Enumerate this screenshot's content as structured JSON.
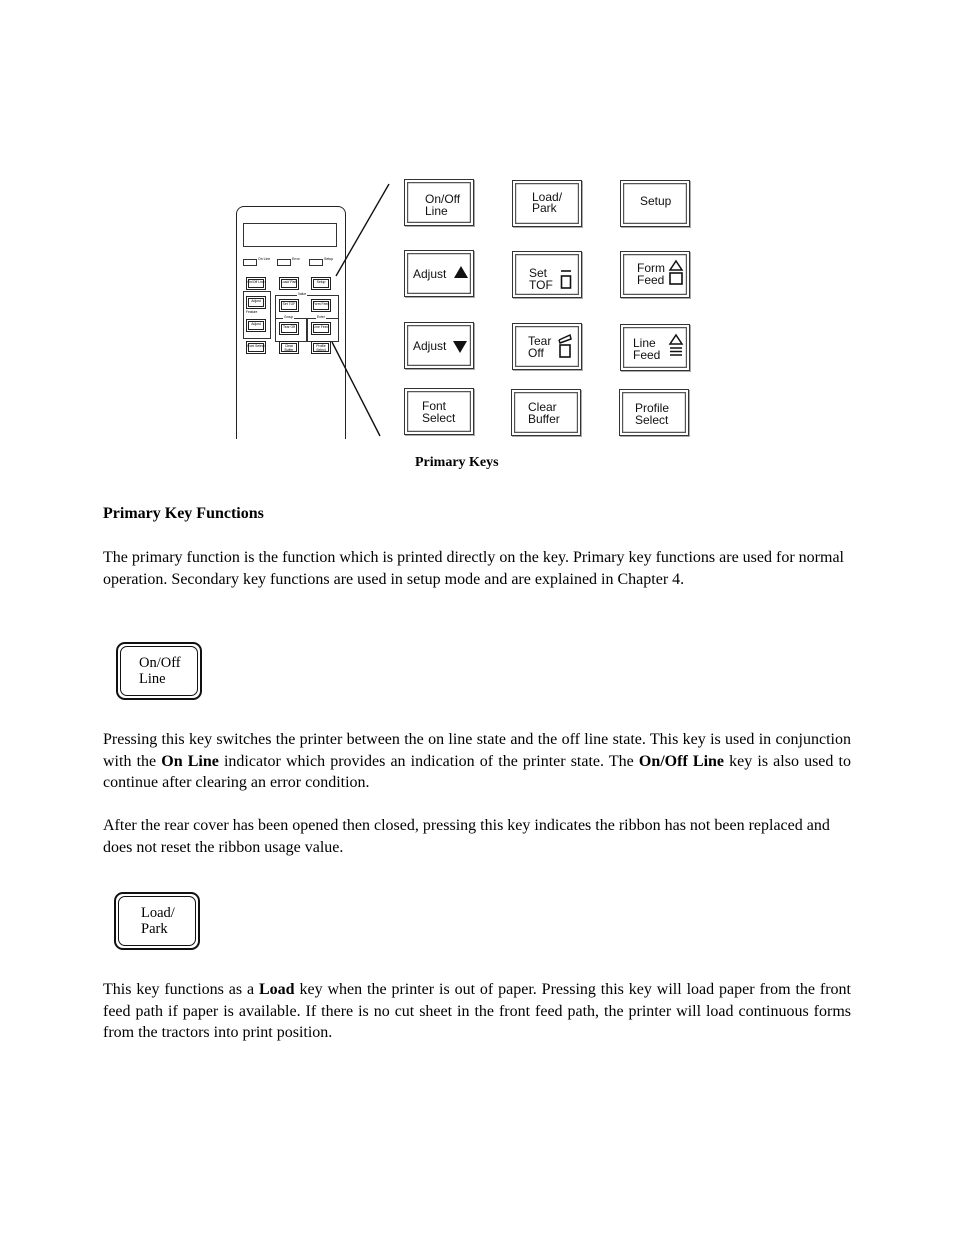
{
  "figure": {
    "caption": "Primary Keys",
    "panel": {
      "indicators": [
        "On Line",
        "Error",
        "Setup"
      ],
      "group_labels": [
        "Value",
        "Feature",
        "Group",
        "Enter"
      ],
      "keys": [
        "On/Off Line",
        "Load/ Park",
        "Setup",
        "Adjust",
        "Set TOF",
        "Form Feed",
        "Adjust",
        "Tear Off",
        "Line Feed",
        "Font Select",
        "Clear Buffer",
        "Profile Select"
      ]
    },
    "keys": [
      {
        "line1": "On/Off",
        "line2": "Line",
        "icon": ""
      },
      {
        "line1": "Load/",
        "line2": "Park",
        "icon": ""
      },
      {
        "line1": "Setup",
        "line2": "",
        "icon": ""
      },
      {
        "line1": "Adjust",
        "line2": "",
        "icon": "triangle-up-icon"
      },
      {
        "line1": "Set",
        "line2": "TOF",
        "icon": "set-tof-icon"
      },
      {
        "line1": "Form",
        "line2": "Feed",
        "icon": "form-feed-icon"
      },
      {
        "line1": "Adjust",
        "line2": "",
        "icon": "triangle-down-icon"
      },
      {
        "line1": "Tear",
        "line2": "Off",
        "icon": "tear-off-icon"
      },
      {
        "line1": "Line",
        "line2": "Feed",
        "icon": "line-feed-icon"
      },
      {
        "line1": "Font",
        "line2": "Select",
        "icon": ""
      },
      {
        "line1": "Clear",
        "line2": "Buffer",
        "icon": ""
      },
      {
        "line1": "Profile",
        "line2": "Select",
        "icon": ""
      }
    ]
  },
  "section": {
    "heading": "Primary Key Functions",
    "intro": "The primary function is the function which is printed directly on the key. Primary key functions are used for normal operation. Secondary key functions are used in setup mode and are explained in Chapter 4."
  },
  "on_off_line": {
    "key_line1": "On/Off",
    "key_line2": "Line",
    "p1": {
      "a": "Pressing this key switches the printer between the on line state and the off line state. This key is used in conjunction with the ",
      "b1": "On Line",
      "c": " indicator which provides an indication of the printer state. The ",
      "b2": "On/Off Line",
      "d": " key is also used to continue after clearing an error condition."
    },
    "p2": "After the rear cover has been opened then closed, pressing this key indicates the ribbon has not been replaced and does not reset the ribbon usage value."
  },
  "load_park": {
    "key_line1": "Load/",
    "key_line2": "Park",
    "p1": {
      "a": "This key functions as a ",
      "b1": "Load",
      "c": " key when the printer is out of paper. Pressing this key will load paper from the front feed path if paper is available. If there is no cut sheet in the front feed path, the printer will load continuous forms from the tractors into print position."
    }
  }
}
